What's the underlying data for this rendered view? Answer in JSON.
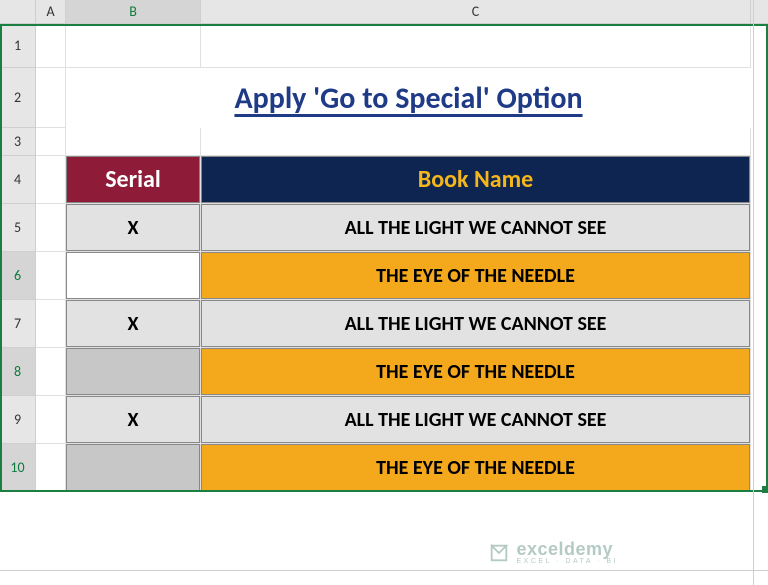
{
  "columns": {
    "A": "A",
    "B": "B",
    "C": "C"
  },
  "rows": {
    "1": "1",
    "2": "2",
    "3": "3",
    "4": "4",
    "5": "5",
    "6": "6",
    "7": "7",
    "8": "8",
    "9": "9",
    "10": "10"
  },
  "title": "Apply 'Go to Special' Option",
  "headers": {
    "serial": "Serial",
    "book": "Book Name"
  },
  "data": [
    {
      "serial": "X",
      "book": "ALL THE LIGHT WE CANNOT SEE",
      "bg": "grey",
      "selected": false,
      "active": false
    },
    {
      "serial": "",
      "book": "THE EYE OF THE NEEDLE",
      "bg": "orange",
      "selected": true,
      "active": true
    },
    {
      "serial": "X",
      "book": "ALL THE LIGHT WE CANNOT SEE",
      "bg": "grey",
      "selected": false,
      "active": false
    },
    {
      "serial": "",
      "book": "THE EYE OF THE NEEDLE",
      "bg": "orange",
      "selected": true,
      "active": false
    },
    {
      "serial": "X",
      "book": "ALL THE LIGHT WE CANNOT SEE",
      "bg": "grey",
      "selected": false,
      "active": false
    },
    {
      "serial": "",
      "book": "THE EYE OF THE NEEDLE",
      "bg": "orange",
      "selected": true,
      "active": false
    }
  ],
  "watermark": {
    "main": "exceldemy",
    "sub": "EXCEL · DATA · BI"
  },
  "chart_data": {
    "type": "table",
    "title": "Apply 'Go to Special' Option",
    "columns": [
      "Serial",
      "Book Name"
    ],
    "rows": [
      [
        "X",
        "ALL THE LIGHT WE CANNOT SEE"
      ],
      [
        "",
        "THE EYE OF THE NEEDLE"
      ],
      [
        "X",
        "ALL THE LIGHT WE CANNOT SEE"
      ],
      [
        "",
        "THE EYE OF THE NEEDLE"
      ],
      [
        "X",
        "ALL THE LIGHT WE CANNOT SEE"
      ],
      [
        "",
        "THE EYE OF THE NEEDLE"
      ]
    ]
  }
}
